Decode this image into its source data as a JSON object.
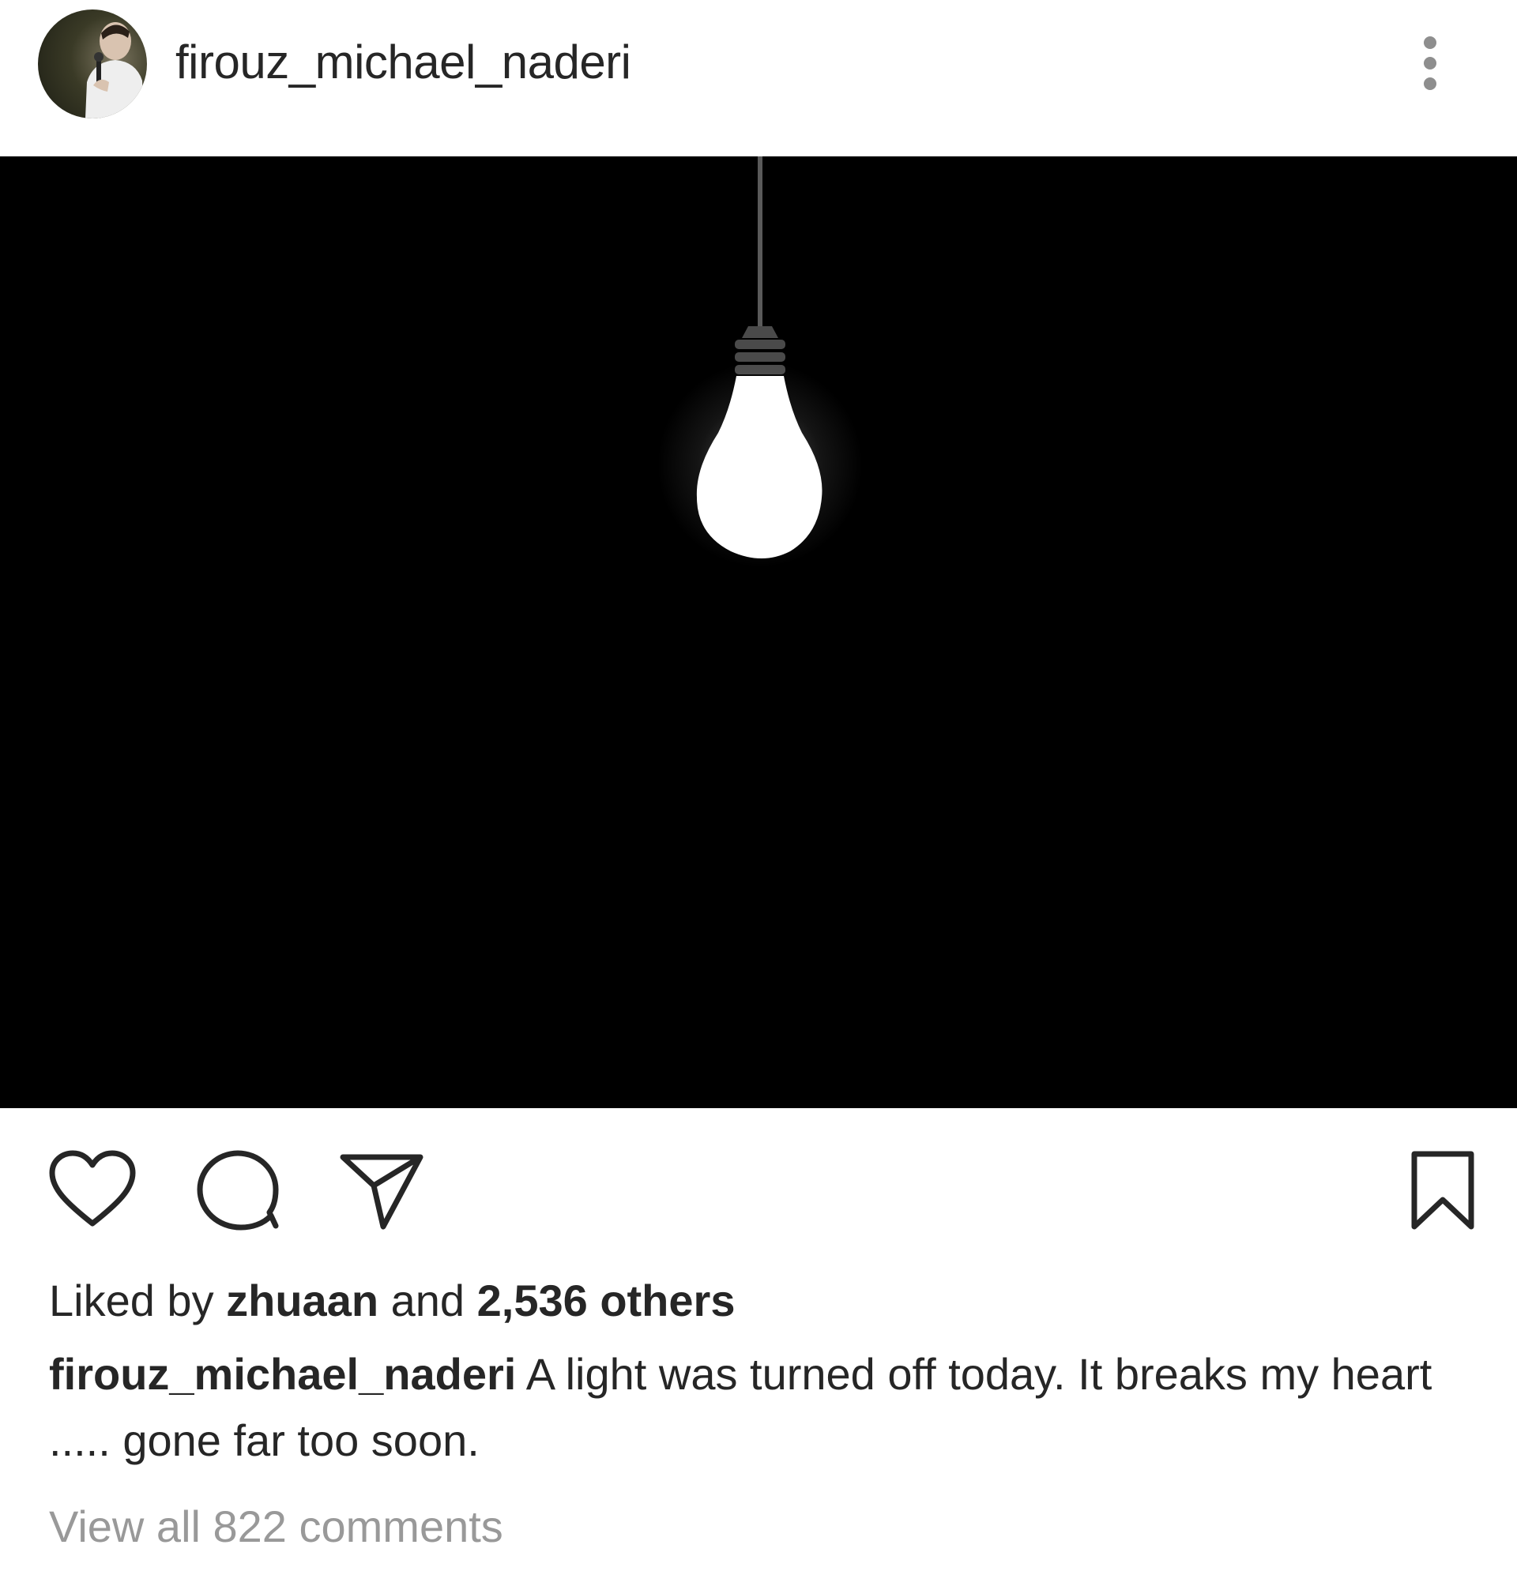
{
  "post": {
    "username": "firouz_michael_naderi",
    "avatar_icon": "profile-photo",
    "more_icon": "more-vertical-icon"
  },
  "actions": {
    "like_icon": "heart-icon",
    "comment_icon": "comment-icon",
    "share_icon": "send-icon",
    "save_icon": "bookmark-icon"
  },
  "likes": {
    "prefix": "Liked by",
    "user": "zhuaan",
    "conjunction": "and",
    "others": "2,536 others"
  },
  "caption": {
    "username": "firouz_michael_naderi",
    "text": "A light was turned off today. It breaks my heart ..... gone far too soon."
  },
  "comments": {
    "view_all": "View all 822 comments"
  },
  "colors": {
    "text": "#262626",
    "muted": "#999999",
    "media_background": "#000000",
    "bulb": "#ffffff"
  }
}
